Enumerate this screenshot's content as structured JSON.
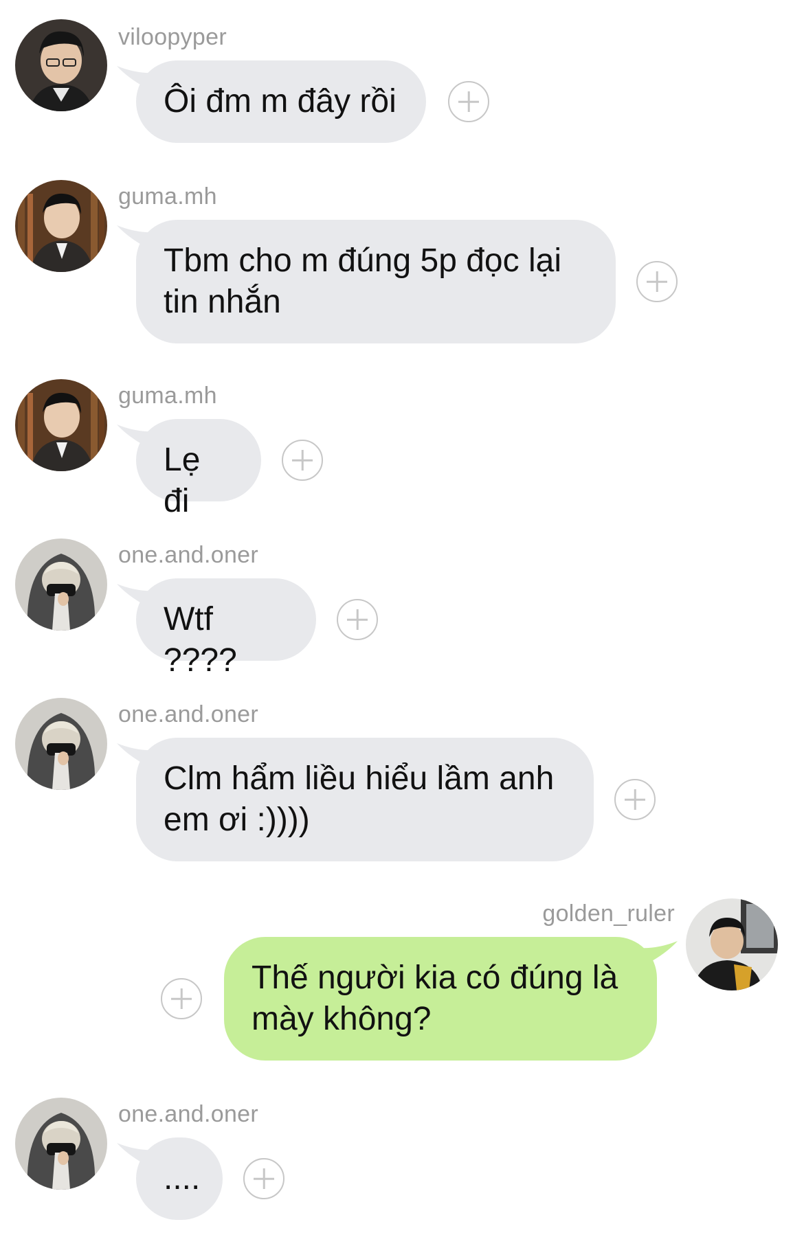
{
  "messages": [
    {
      "user": "viloopyper",
      "text": "Ôi đm m đây rồi",
      "side": "in",
      "avatar": "avatar-man-glasses"
    },
    {
      "user": "guma.mh",
      "text": "Tbm cho m đúng 5p đọc lại tin nhắn",
      "side": "in",
      "avatar": "avatar-man-library"
    },
    {
      "user": "guma.mh",
      "text": "Lẹ đi",
      "side": "in",
      "avatar": "avatar-man-library"
    },
    {
      "user": "one.and.oner",
      "text": "Wtf ????",
      "side": "in",
      "avatar": "avatar-hooded-mask"
    },
    {
      "user": "one.and.oner",
      "text": "Clm hẩm liều hiểu lầm anh em ơi :))))",
      "side": "in",
      "avatar": "avatar-hooded-mask"
    },
    {
      "user": "golden_ruler",
      "text": "Thế người kia có đúng là mày không?",
      "side": "out",
      "avatar": "avatar-man-headset"
    },
    {
      "user": "one.and.oner",
      "text": "....",
      "side": "in",
      "avatar": "avatar-hooded-mask"
    }
  ],
  "colors": {
    "incoming_bubble": "#e8e9ec",
    "outgoing_bubble": "#c6ee98",
    "username": "#9a9a9a",
    "reaction_icon": "#c7c7c7"
  },
  "icons": {
    "reaction": "add-reaction-icon"
  }
}
